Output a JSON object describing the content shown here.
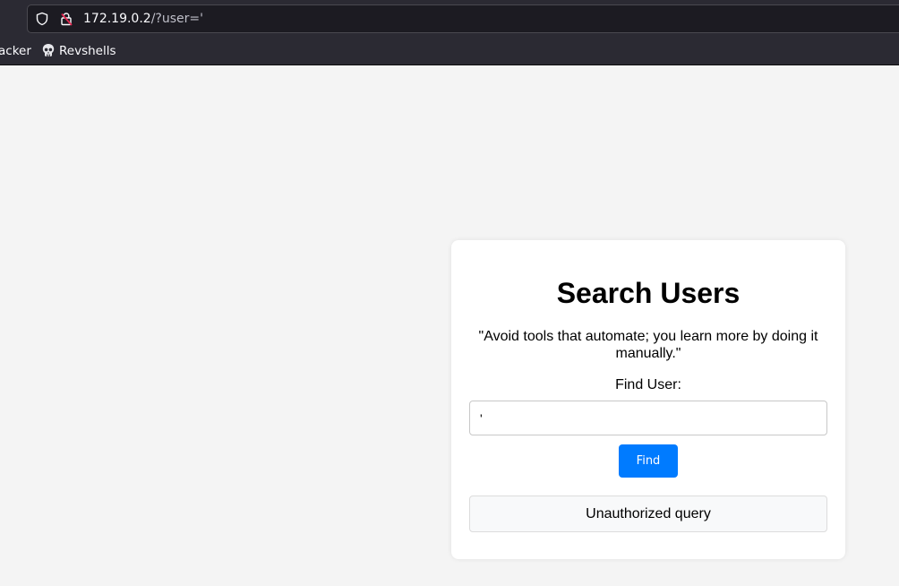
{
  "browser": {
    "url_host": "172.19.0.2",
    "url_path": "/?user='",
    "bookmarks": [
      {
        "label": "acker",
        "icon": "none"
      },
      {
        "label": "Revshells",
        "icon": "skull-icon"
      }
    ]
  },
  "page": {
    "title": "Search Users",
    "quote": "\"Avoid tools that automate; you learn more by doing it manually.\"",
    "find_label": "Find User:",
    "input_value": "'",
    "find_button_label": "Find",
    "result_text": "Unauthorized query"
  },
  "colors": {
    "page_background": "#f4f4f4",
    "button_blue": "#007bff",
    "browser_chrome": "#2b2a33"
  }
}
